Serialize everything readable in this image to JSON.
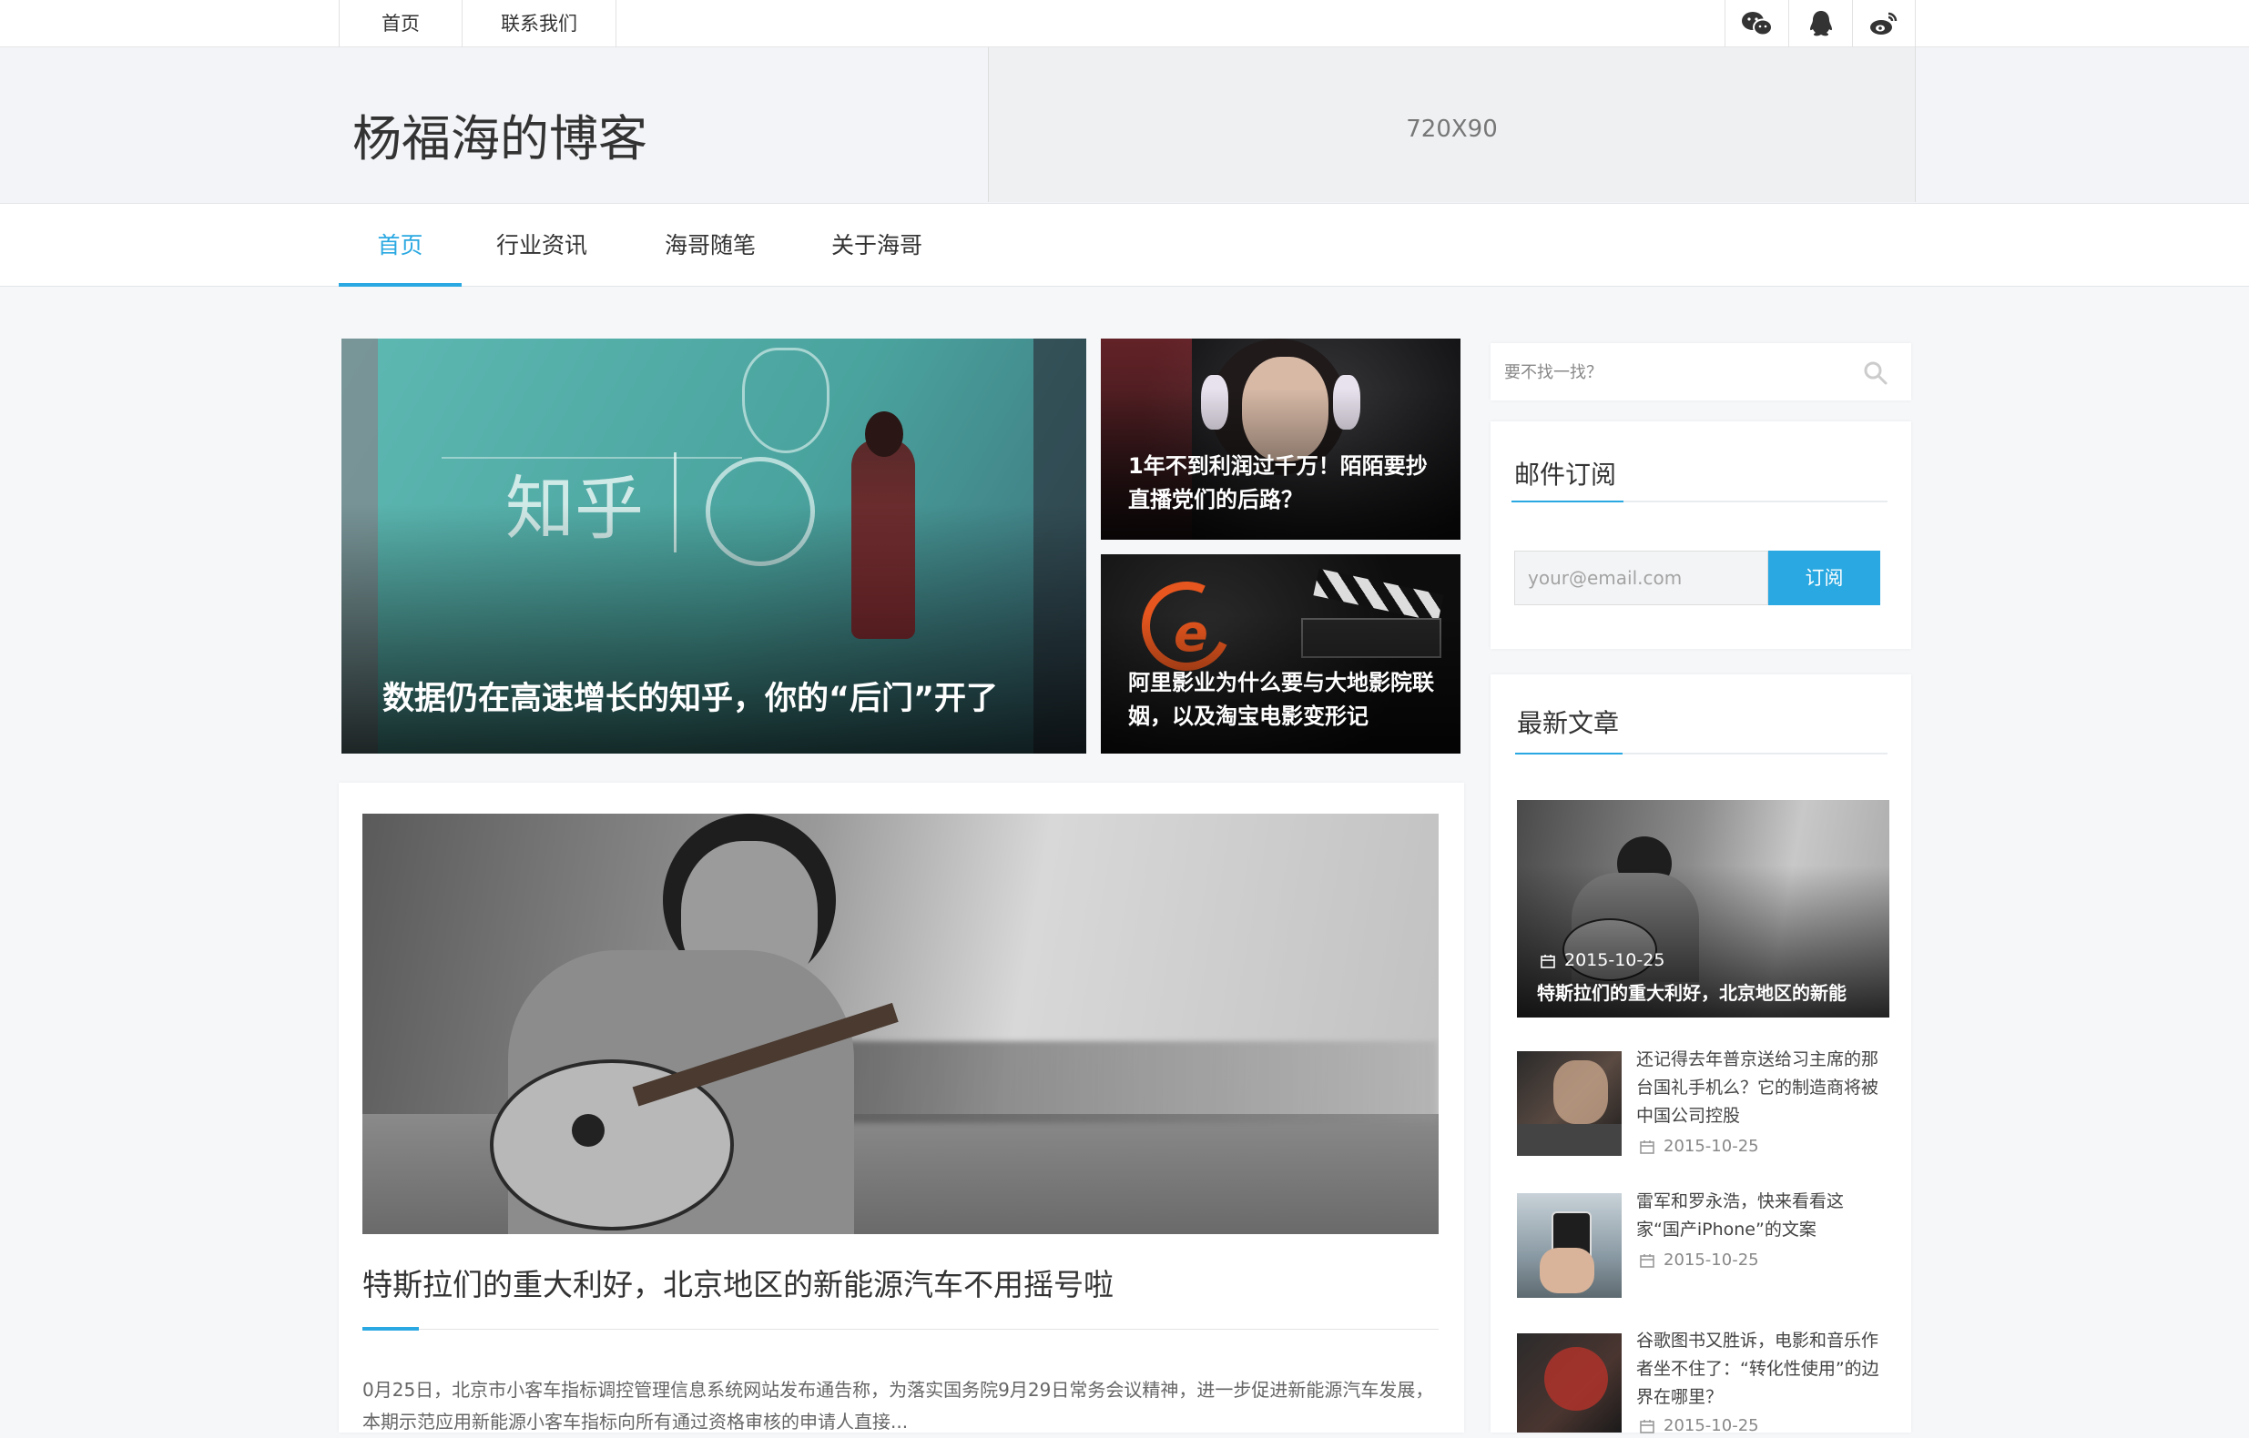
{
  "topbar": {
    "links": [
      "首页",
      "联系我们"
    ],
    "social_icons": [
      "wechat-icon",
      "qq-icon",
      "weibo-icon"
    ]
  },
  "header": {
    "site_title": "杨福海的博客",
    "ad_text": "720X90"
  },
  "mainnav": {
    "items": [
      "首页",
      "行业资讯",
      "海哥随笔",
      "关于海哥"
    ],
    "active_index": 0
  },
  "slides": [
    {
      "title": "数据仍在高速增长的知乎，你的“后门”开了"
    },
    {
      "title": "1年不到利润过千万！陌陌要抄直播党们的后路？"
    },
    {
      "title": "阿里影业为什么要与大地影院联姻，以及淘宝电影变形记"
    }
  ],
  "post": {
    "title": "特斯拉们的重大利好，北京地区的新能源汽车不用摇号啦",
    "excerpt": "0月25日，北京市小客车指标调控管理信息系统网站发布通告称，为落实国务院9月29日常务会议精神，进一步促进新能源汽车发展，本期示范应用新能源小客车指标向所有通过资格审核的申请人直接..."
  },
  "sidebar": {
    "search_placeholder": "要不找一找？",
    "subscribe": {
      "title": "邮件订阅",
      "email_placeholder": "your@email.com",
      "button_label": "订阅"
    },
    "recent": {
      "title": "最新文章",
      "featured": {
        "date": "2015-10-25",
        "title": "特斯拉们的重大利好，北京地区的新能"
      },
      "items": [
        {
          "title": "还记得去年普京送给习主席的那台国礼手机么？它的制造商将被中国公司控股",
          "date": "2015-10-25"
        },
        {
          "title": "雷军和罗永浩，快来看看这家“国产iPhone”的文案",
          "date": "2015-10-25"
        },
        {
          "title": "谷歌图书又胜诉，电影和音乐作者坐不住了：“转化性使用”的边界在哪里？",
          "date": "2015-10-25"
        }
      ]
    }
  },
  "colors": {
    "accent": "#29a8e1",
    "page_bg": "#f5f7f9"
  }
}
